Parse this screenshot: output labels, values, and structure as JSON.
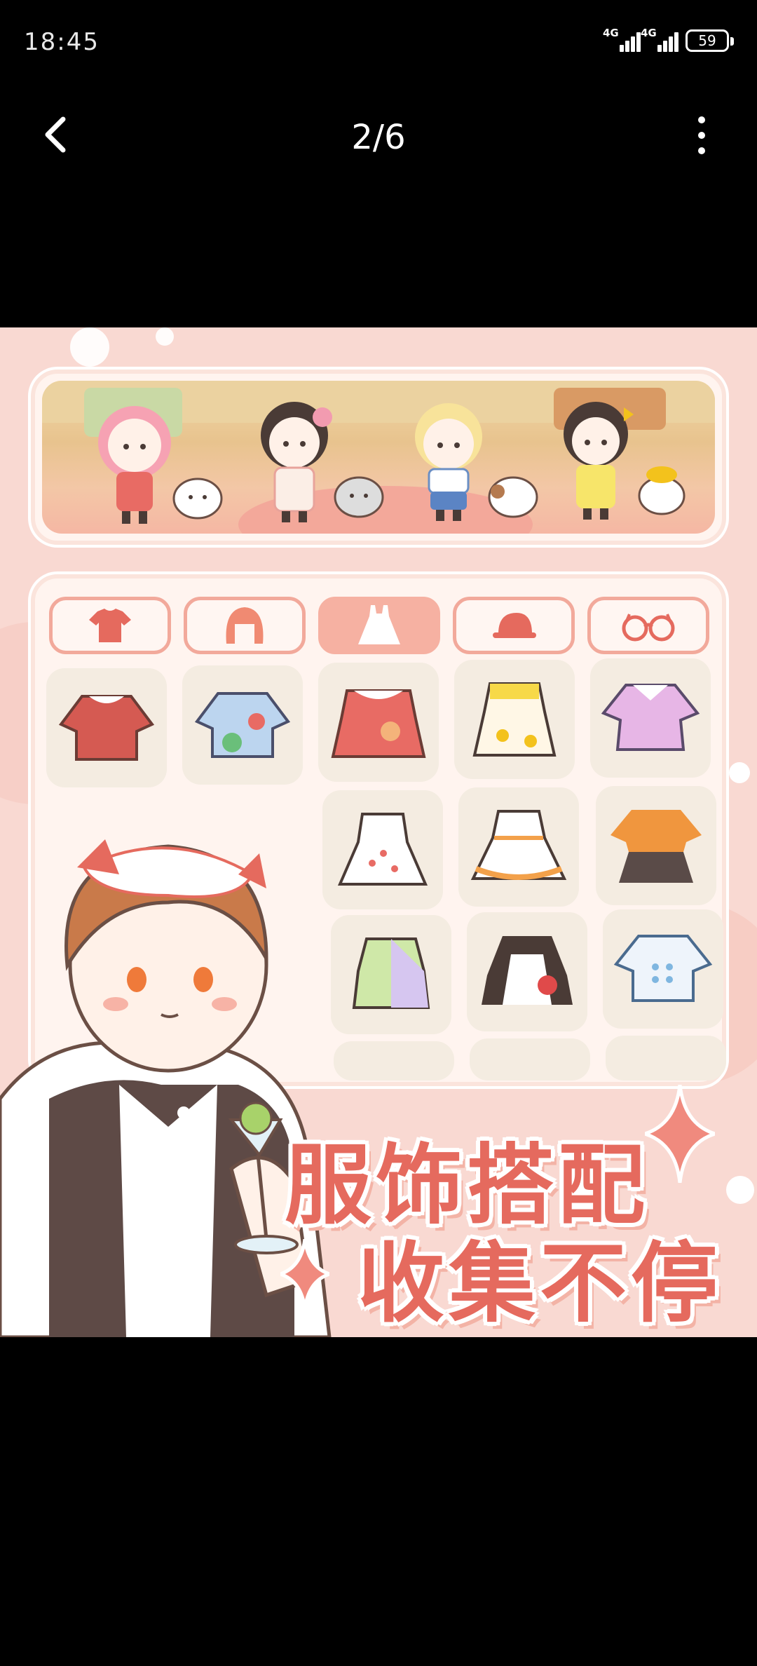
{
  "status_bar": {
    "time": "18:45",
    "signal_1_label": "4G",
    "signal_2_label": "4G",
    "battery": "59"
  },
  "nav": {
    "page_counter": "2/6",
    "back_icon": "chevron-left-icon",
    "more_icon": "more-vertical-icon"
  },
  "promo": {
    "headline_line1": "服饰搭配",
    "headline_line2": "收集不停",
    "tabs": [
      {
        "icon": "shirt-icon",
        "active": false
      },
      {
        "icon": "hair-icon",
        "active": false
      },
      {
        "icon": "dress-icon",
        "active": true
      },
      {
        "icon": "hat-icon",
        "active": false
      },
      {
        "icon": "glasses-icon",
        "active": false
      }
    ],
    "colors": {
      "background": "#f9d9d2",
      "accent": "#e56a5e",
      "tab_border": "#f2a99b",
      "tab_active": "#f6b1a2"
    }
  }
}
